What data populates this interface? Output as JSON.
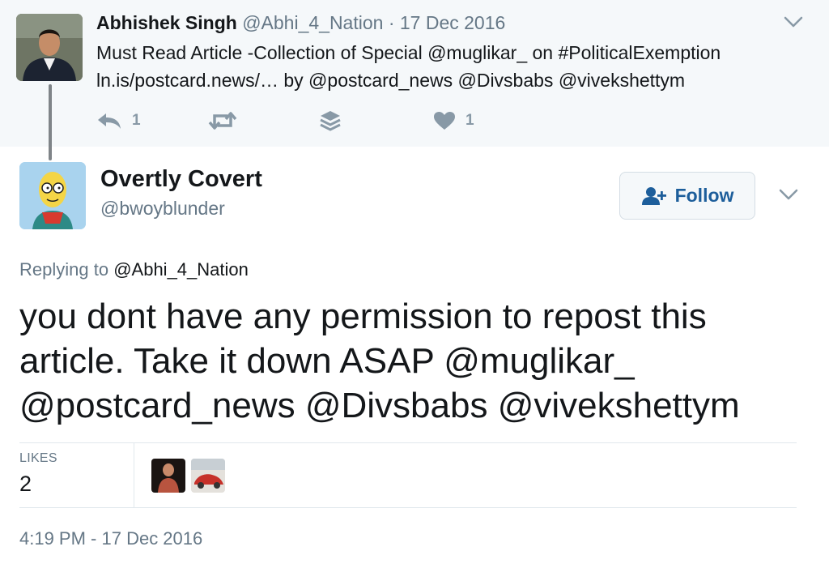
{
  "parent_tweet": {
    "name": "Abhishek Singh",
    "meta": "@Abhi_4_Nation · 17 Dec 2016",
    "text_line1": "Must Read Article -Collection of Special @muglikar_ on #PoliticalExemption",
    "text_line2": "ln.is/postcard.news/… by @postcard_news @Divsbabs @vivekshettym",
    "reply_count": "1",
    "like_count": "1"
  },
  "tweet": {
    "name": "Overtly Covert",
    "handle": "@bwoyblunder",
    "follow_label": "Follow",
    "replying_prefix": "Replying to",
    "replying_handle": "@Abhi_4_Nation",
    "text": "you dont have any permission to repost this article. Take it down ASAP @muglikar_ @postcard_news @Divsbabs @vivekshettym",
    "likes_label": "LIKES",
    "likes_count": "2",
    "timestamp": "4:19 PM - 17 Dec 2016"
  },
  "icons": {
    "reply": "reply-icon",
    "retweet": "retweet-icon",
    "stack": "layers-icon",
    "like": "heart-icon",
    "more": "chevron-down-icon",
    "follow": "add-user-icon"
  },
  "colors": {
    "accent": "#1d5e9b",
    "muted": "#657786",
    "icon_gray": "#8899a6",
    "parent_bg": "#f5f8fa"
  }
}
